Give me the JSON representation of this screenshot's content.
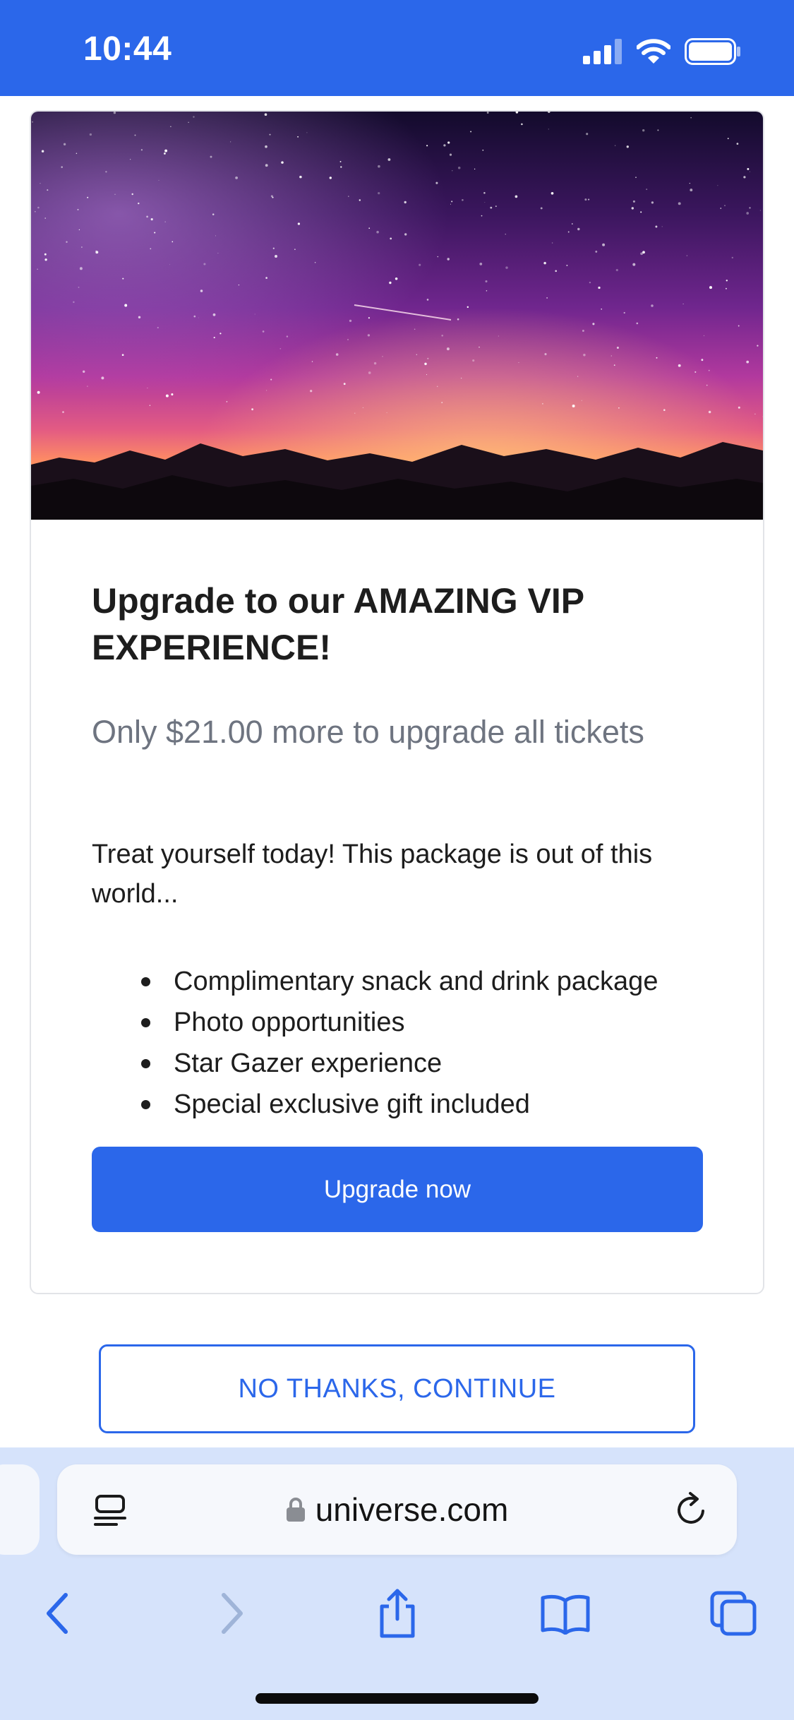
{
  "status_bar": {
    "time": "10:44",
    "background_color": "#2b67ea",
    "icons": [
      "cellular-signal-icon",
      "wifi-icon",
      "battery-icon"
    ]
  },
  "offer_card": {
    "hero_image": "night-sky-milky-way-image",
    "title": "Upgrade to our AMAZING VIP EXPERIENCE!",
    "subtitle": "Only $21.00 more to upgrade all tickets",
    "description": "Treat yourself today! This package is out of this world...",
    "features": [
      "Complimentary snack and drink package",
      "Photo opportunities",
      "Star Gazer experience",
      "Special exclusive gift included"
    ],
    "upgrade_button_label": "Upgrade now"
  },
  "secondary_action": {
    "label": "NO THANKS, CONTINUE"
  },
  "browser": {
    "url": "universe.com",
    "icons": [
      "reader-mode-icon",
      "lock-icon",
      "reload-icon",
      "back-icon",
      "forward-icon",
      "share-icon",
      "bookmarks-icon",
      "tabs-icon"
    ]
  },
  "colors": {
    "accent": "#2b67ea",
    "browser_chrome": "#d6e3fb",
    "subtitle_gray": "#6e7480"
  }
}
